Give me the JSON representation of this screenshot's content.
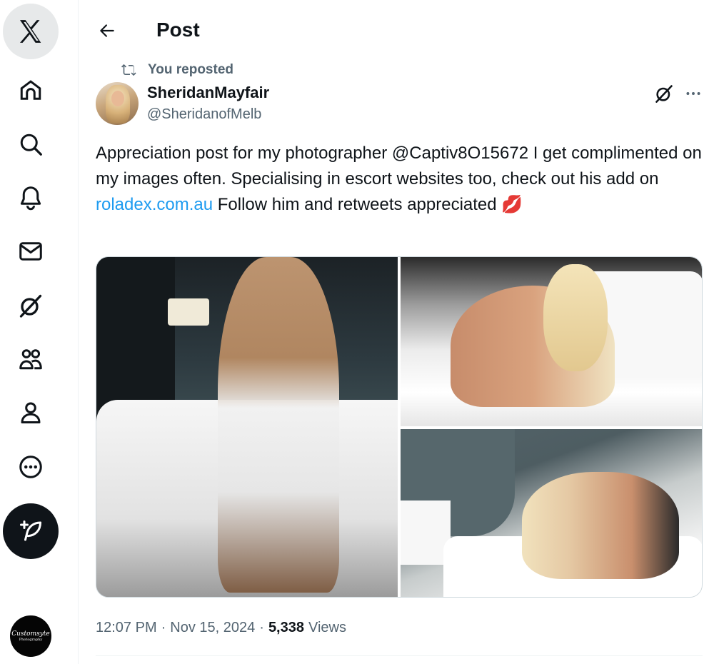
{
  "colors": {
    "text_primary": "#0f1419",
    "text_secondary": "#536471",
    "link": "#1d9bf0",
    "border": "#cfd9de",
    "post_button": "#0f1419"
  },
  "nav": {
    "logo_icon": "x-logo-icon",
    "items": [
      {
        "name": "home",
        "icon": "home-icon"
      },
      {
        "name": "explore",
        "icon": "search-icon"
      },
      {
        "name": "notifications",
        "icon": "bell-icon"
      },
      {
        "name": "messages",
        "icon": "mail-icon"
      },
      {
        "name": "grok",
        "icon": "grok-icon"
      },
      {
        "name": "communities",
        "icon": "communities-icon"
      },
      {
        "name": "profile",
        "icon": "person-icon"
      },
      {
        "name": "more",
        "icon": "more-circle-icon"
      }
    ],
    "post_button_icon": "compose-feather-icon",
    "account": {
      "brand_line_1": "Customsyte",
      "brand_line_2": "Photography"
    }
  },
  "header": {
    "title": "Post",
    "back_icon": "arrow-left-icon"
  },
  "tweet": {
    "repost_label": "You reposted",
    "author_name": "SheridanMayfair",
    "author_handle": "@SheridanofMelb",
    "text_before_link": "Appreciation post for my photographer @Captiv8O15672 I get complimented on my images often. Specialising in escort websites too, check out his add on ",
    "link_text": "roladex.com.au",
    "text_after_link": " Follow him and retweets appreciated ",
    "emoji": "💋",
    "media_count": 3,
    "time": "12:07 PM",
    "date": "Nov 15, 2024",
    "views_count": "5,338",
    "views_label": "Views",
    "separator": "·"
  }
}
